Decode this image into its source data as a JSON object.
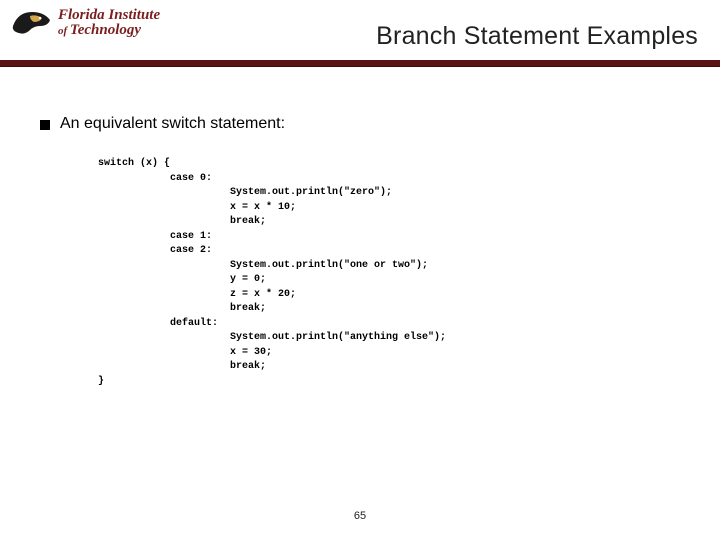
{
  "header": {
    "institution_line1": "Florida Institute",
    "institution_line2_prefix": "of ",
    "institution_line2": "Technology",
    "slide_title": "Branch Statement Examples"
  },
  "bullet": {
    "text": "An equivalent switch statement:"
  },
  "code": {
    "text": "switch (x) {\n            case 0:\n                      System.out.println(\"zero\");\n                      x = x * 10;\n                      break;\n            case 1:\n            case 2:\n                      System.out.println(\"one or two\");\n                      y = 0;\n                      z = x * 20;\n                      break;\n            default:\n                      System.out.println(\"anything else\");\n                      x = 30;\n                      break;\n}"
  },
  "footer": {
    "page_number": "65"
  }
}
